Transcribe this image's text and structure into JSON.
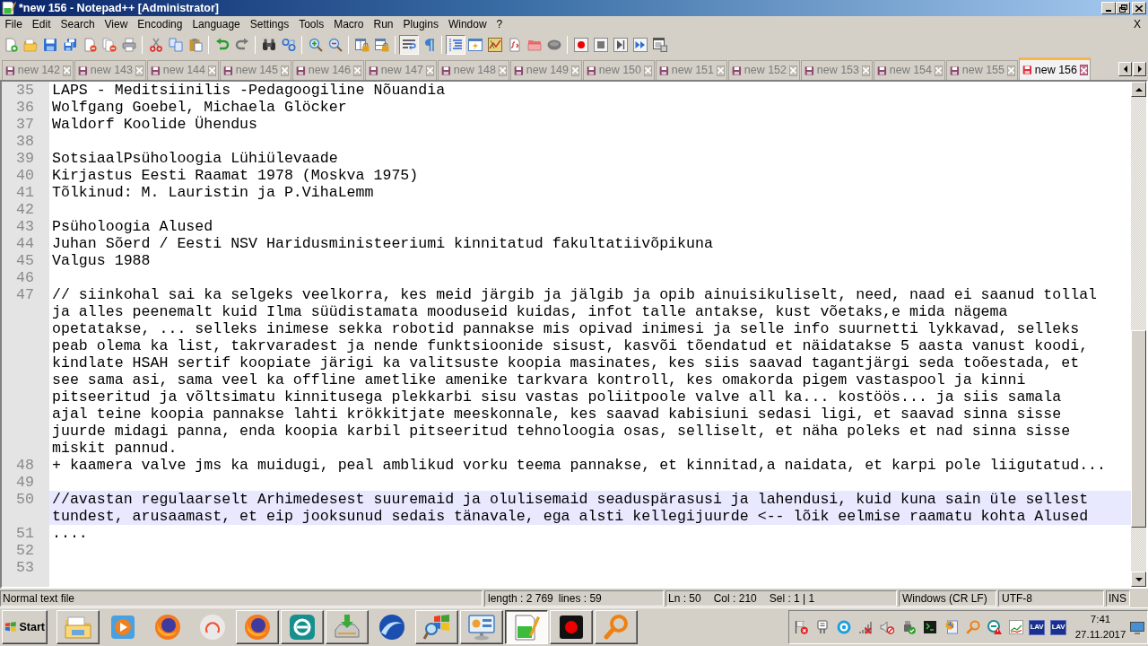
{
  "window": {
    "title": "*new 156 - Notepad++ [Administrator]"
  },
  "menu_bar": {
    "items": [
      "File",
      "Edit",
      "Search",
      "View",
      "Encoding",
      "Language",
      "Settings",
      "Tools",
      "Macro",
      "Run",
      "Plugins",
      "Window",
      "?"
    ],
    "close_document": "X"
  },
  "toolbar": {
    "groups": [
      [
        {
          "kind": "new",
          "pressed": false
        },
        {
          "kind": "open",
          "pressed": false
        },
        {
          "kind": "save",
          "pressed": false
        },
        {
          "kind": "save_all",
          "pressed": false
        },
        {
          "kind": "close",
          "pressed": false
        },
        {
          "kind": "close_all",
          "pressed": false
        },
        {
          "kind": "print",
          "pressed": false
        }
      ],
      [
        {
          "kind": "cut",
          "pressed": false
        },
        {
          "kind": "copy",
          "pressed": false
        },
        {
          "kind": "paste",
          "pressed": false
        }
      ],
      [
        {
          "kind": "undo",
          "pressed": false
        },
        {
          "kind": "redo",
          "pressed": false
        }
      ],
      [
        {
          "kind": "find",
          "pressed": false
        },
        {
          "kind": "replace",
          "pressed": false
        }
      ],
      [
        {
          "kind": "zoom_in",
          "pressed": false
        },
        {
          "kind": "zoom_out",
          "pressed": false
        }
      ],
      [
        {
          "kind": "sync_vertical",
          "pressed": false
        },
        {
          "kind": "sync_horizontal",
          "pressed": false
        }
      ],
      [
        {
          "kind": "word_wrap",
          "pressed": true
        },
        {
          "kind": "all_characters",
          "pressed": false
        }
      ],
      [
        {
          "kind": "indent_guide",
          "pressed": true
        },
        {
          "kind": "user_language",
          "pressed": false
        },
        {
          "kind": "document_map",
          "pressed": false
        },
        {
          "kind": "function_list",
          "pressed": false
        },
        {
          "kind": "folder_workspace",
          "pressed": false
        },
        {
          "kind": "monitoring",
          "pressed": false
        }
      ],
      [
        {
          "kind": "record",
          "pressed": false
        },
        {
          "kind": "stop",
          "pressed": false
        },
        {
          "kind": "play",
          "pressed": false
        },
        {
          "kind": "play_multiple",
          "pressed": false
        },
        {
          "kind": "save_macro",
          "pressed": false
        }
      ]
    ]
  },
  "tabs": [
    {
      "label": "new 142",
      "selected": false
    },
    {
      "label": "new 143",
      "selected": false
    },
    {
      "label": "new 144",
      "selected": false
    },
    {
      "label": "new 145",
      "selected": false
    },
    {
      "label": "new 146",
      "selected": false
    },
    {
      "label": "new 147",
      "selected": false
    },
    {
      "label": "new 148",
      "selected": false
    },
    {
      "label": "new 149",
      "selected": false
    },
    {
      "label": "new 150",
      "selected": false
    },
    {
      "label": "new 151",
      "selected": false
    },
    {
      "label": "new 152",
      "selected": false
    },
    {
      "label": "new 153",
      "selected": false
    },
    {
      "label": "new 154",
      "selected": false
    },
    {
      "label": "new 155",
      "selected": false
    },
    {
      "label": "new 156",
      "selected": true
    }
  ],
  "editor": {
    "lines": [
      {
        "number": "35",
        "current": false,
        "rows": [
          "LAPS - Meditsiinilis -Pedagoogiline Nõuandia"
        ]
      },
      {
        "number": "36",
        "current": false,
        "rows": [
          "Wolfgang Goebel, Michaela Glöcker"
        ]
      },
      {
        "number": "37",
        "current": false,
        "rows": [
          "Waldorf Koolide Ühendus"
        ]
      },
      {
        "number": "38",
        "current": false
      },
      {
        "number": "39",
        "current": false,
        "rows": [
          "SotsiaalPsüholoogia Lühiülevaade"
        ]
      },
      {
        "number": "40",
        "current": false,
        "rows": [
          "Kirjastus Eesti Raamat 1978 (Moskva 1975)"
        ]
      },
      {
        "number": "41",
        "current": false,
        "rows": [
          "Tõlkinud: M. Lauristin ja P.VihaLemm"
        ]
      },
      {
        "number": "42",
        "current": false
      },
      {
        "number": "43",
        "current": false,
        "rows": [
          "Psüholoogia Alused"
        ]
      },
      {
        "number": "44",
        "current": false,
        "rows": [
          "Juhan Sõerd / Eesti NSV Haridusministeeriumi kinnitatud fakultatiivõpikuna"
        ]
      },
      {
        "number": "45",
        "current": false,
        "rows": [
          "Valgus 1988"
        ]
      },
      {
        "number": "46",
        "current": false
      },
      {
        "number": "47",
        "current": false,
        "rows": [
          "// siinkohal sai ka selgeks veelkorra, kes meid järgib ja jälgib ja opib ainuisikuliselt, need, naad ei saanud tollal",
          "ja alles peenemalt kuid Ilma süüdistamata mooduseid kuidas, infot talle antakse, kust võetaks,e mida nägema",
          "opetatakse, ... selleks inimese sekka robotid pannakse mis opivad inimesi ja selle info suurnetti lykkavad, selleks",
          "peab olema ka list, takrvaradest ja nende funktsioonide sisust, kasvõi tõendatud et näidatakse 5 aasta vanust koodi,",
          "kindlate HSAH sertif koopiate järigi ka valitsuste koopia masinates, kes siis saavad tagantjärgi seda toõestada, et",
          "see sama asi, sama veel ka offline ametlike amenike tarkvara kontroll, kes omakorda pigem vastaspool ja kinni",
          "pitseeritud ja võltsimatu kinnitusega plekkarbi sisu vastas poliitpoole valve all ka... kostöös... ja siis samala",
          "ajal teine koopia pannakse lahti krökkitjate meeskonnale, kes saavad kabisiuni sedasi ligi, et saavad sinna sisse",
          "juurde midagi panna, enda koopia karbil pitseeritud tehnoloogia osas, selliselt, et näha poleks et nad sinna sisse",
          "miskit pannud."
        ]
      },
      {
        "number": "48",
        "current": false,
        "rows": [
          "+ kaamera valve jms ka muidugi, peal amblikud vorku teema pannakse, et kinnitad,a naidata, et karpi pole liigutatud..."
        ]
      },
      {
        "number": "49",
        "current": false
      },
      {
        "number": "50",
        "current": true,
        "rows": [
          "//avastan regulaarselt Arhimedesest suuremaid ja olulisemaid seaduspärasusi ja lahendusi, kuid kuna sain üle sellest",
          "tundest, arusaamast, et eip jooksunud sedais tänavale, ega alsti kellegijuurde <-- lõik eelmise raamatu kohta Alused"
        ]
      },
      {
        "number": "51",
        "current": false,
        "rows": [
          "...."
        ]
      },
      {
        "number": "52",
        "current": false
      },
      {
        "number": "53",
        "current": false
      }
    ]
  },
  "status_bar": {
    "file_type": "Normal text file",
    "length": "length : 2 769",
    "lines": "lines : 59",
    "line": "Ln : 50",
    "column": "Col : 210",
    "selection": "Sel : 1 | 1",
    "eol": "Windows (CR LF)",
    "encoding": "UTF-8",
    "mode": "INS"
  },
  "taskbar": {
    "start": "Start",
    "buttons": [
      {
        "kind": "folder",
        "open": true,
        "active": false
      },
      {
        "kind": "media",
        "open": false,
        "active": false
      },
      {
        "kind": "browser",
        "open": false,
        "active": false
      },
      {
        "kind": "antivirus",
        "open": false,
        "active": false
      },
      {
        "kind": "browser",
        "open": true,
        "active": false
      },
      {
        "kind": "security",
        "open": true,
        "active": false
      },
      {
        "kind": "drive",
        "open": true,
        "active": false
      },
      {
        "kind": "sphere",
        "open": false,
        "active": false
      },
      {
        "kind": "win_search",
        "open": true,
        "active": false
      },
      {
        "kind": "control_panel",
        "open": true,
        "active": false
      },
      {
        "kind": "notepad",
        "open": true,
        "active": true
      },
      {
        "kind": "recorder",
        "open": true,
        "active": false
      },
      {
        "kind": "search",
        "open": true,
        "active": false
      }
    ],
    "tray_tiles": [
      "LAV",
      "LAV"
    ],
    "clock": {
      "time": "7:41",
      "date": "27.11.2017"
    }
  }
}
